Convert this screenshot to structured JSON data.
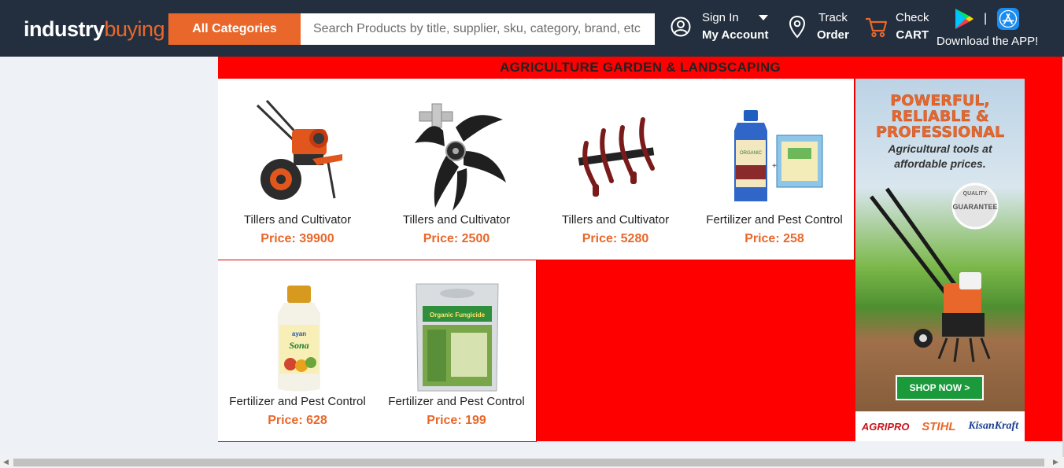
{
  "header": {
    "logo_part1": "industry",
    "logo_part2": "buying",
    "all_categories": "All Categories",
    "search_placeholder": "Search Products by title, supplier, sku, category, brand, etc",
    "sign_in": "Sign In",
    "my_account": "My Account",
    "track": "Track",
    "order": "Order",
    "check": "Check",
    "cart": "CART",
    "app_separator": "|",
    "download_app": "Download the APP!"
  },
  "section": {
    "title": "AGRICULTURE GARDEN & LANDSCAPING",
    "products": [
      {
        "name": "Tillers and Cultivator",
        "price": "Price: 39900",
        "icon": "tiller-machine-icon"
      },
      {
        "name": "Tillers and Cultivator",
        "price": "Price: 2500",
        "icon": "tiller-blade-icon"
      },
      {
        "name": "Tillers and Cultivator",
        "price": "Price: 5280",
        "icon": "cultivator-tines-icon"
      },
      {
        "name": "Fertilizer and Pest Control",
        "price": "Price: 258",
        "icon": "fertilizer-bottle-pack-icon"
      },
      {
        "name": "Fertilizer and Pest Control",
        "price": "Price: 628",
        "icon": "fertilizer-bottle-icon"
      },
      {
        "name": "Fertilizer and Pest Control",
        "price": "Price: 199",
        "icon": "fungicide-pouch-icon"
      }
    ]
  },
  "banner": {
    "headline_1": "POWERFUL,",
    "headline_2": "RELIABLE &",
    "headline_3": "PROFESSIONAL",
    "subline_1": "Agricultural tools at",
    "subline_2": "affordable prices.",
    "badge_1": "QUALITY",
    "badge_2": "GUARANTEE",
    "shop_now": "SHOP NOW >",
    "brand_1": "AGRIPRO",
    "brand_2": "STIHL",
    "brand_3": "KisanKraft"
  },
  "colors": {
    "header_bg": "#232f3e",
    "accent": "#e9672a",
    "section_bg": "#ff0000",
    "shop_button": "#1b9a3c"
  }
}
